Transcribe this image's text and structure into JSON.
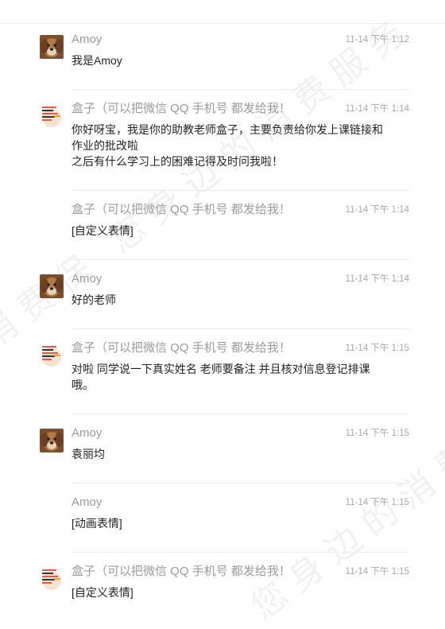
{
  "watermark": {
    "line1": "消费保 您身边的消费服务",
    "line2": "您身边的消费服务"
  },
  "messages": [
    {
      "sender": "Amoy",
      "time": "11-14 下午 1:12",
      "text": "我是Amoy",
      "avatar": "dog-photo-icon"
    },
    {
      "sender": "盒子（可以把微信 QQ 手机号 都发给我！",
      "time": "11-14 下午 1:14",
      "text": "你好呀宝，我是你的助教老师盒子，主要负责给你发上课链接和作业的批改啦\n之后有什么学习上的困难记得及时问我啦！",
      "avatar": "box-sticker-icon"
    },
    {
      "sender": "盒子（可以把微信 QQ 手机号 都发给我！",
      "time": "11-14 下午 1:14",
      "text": "[自定义表情]",
      "avatar": ""
    },
    {
      "sender": "Amoy",
      "time": "11-14 下午 1:14",
      "text": "好的老师",
      "avatar": "dog-photo-icon"
    },
    {
      "sender": "盒子（可以把微信 QQ 手机号 都发给我！",
      "time": "11-14 下午 1:15",
      "text": "对啦 同学说一下真实姓名 老师要备注 并且核对信息登记排课哦。",
      "avatar": "box-sticker-icon"
    },
    {
      "sender": "Amoy",
      "time": "11-14 下午 1:15",
      "text": "袁丽均",
      "avatar": "dog-photo-icon"
    },
    {
      "sender": "Amoy",
      "time": "11-14 下午 1:15",
      "text": "[动画表情]",
      "avatar": ""
    },
    {
      "sender": "盒子（可以把微信 QQ 手机号 都发给我！",
      "time": "11-14 下午 1:15",
      "text": "[自定义表情]",
      "avatar": "box-sticker-icon"
    }
  ]
}
